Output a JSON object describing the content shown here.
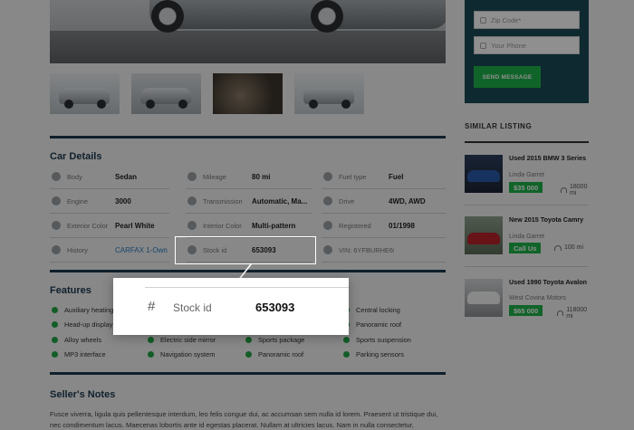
{
  "car_details": {
    "title": "Car Details",
    "rows": [
      [
        {
          "label": "Body",
          "value": "Sedan"
        },
        {
          "label": "Mileage",
          "value": "80 mi"
        },
        {
          "label": "Fuel type",
          "value": "Fuel"
        }
      ],
      [
        {
          "label": "Engine",
          "value": "3000"
        },
        {
          "label": "Transmission",
          "value": "Automatic, Ma..."
        },
        {
          "label": "Drive",
          "value": "4WD, AWD"
        }
      ],
      [
        {
          "label": "Exterior Color",
          "value": "Pearl White"
        },
        {
          "label": "Interior Color",
          "value": "Multi-pattern"
        },
        {
          "label": "Registered",
          "value": "01/1998"
        }
      ],
      [
        {
          "label": "History",
          "value": "CARFAX 1-Owner"
        },
        {
          "label": "Stock id",
          "value": "653093"
        },
        {
          "label": "",
          "value": "VIN: 6YFBURHE6FF213"
        }
      ]
    ]
  },
  "features": {
    "title": "Features",
    "items": [
      [
        "Auxiliary heating",
        "",
        "",
        "Central locking"
      ],
      [
        "Head-up display",
        "",
        "",
        "Panoramic roof"
      ],
      [
        "Alloy wheels",
        "Electric side mirror",
        "Sports package",
        "Sports suspension"
      ],
      [
        "MP3 interface",
        "Navigation system",
        "Panoramic roof",
        "Parking sensors"
      ]
    ]
  },
  "sellers_notes": {
    "title": "Seller's Notes",
    "text": "Fusce viverra, ligula quis pellentesque interdum, leo felis congue dui, ac accumsan sem nulla id lorem. Praesent ut tristique dui, nec condimentum lacus. Maecenas lobortis ante id egestas placerat. Nullam at ultricies lacus. Nam in nulla consectetur,"
  },
  "contact_form": {
    "zip_placeholder": "Zip Code*",
    "phone_placeholder": "Your Phone",
    "send_label": "SEND MESSAGE"
  },
  "similar": {
    "title": "SIMILAR LISTING",
    "items": [
      {
        "title": "Used 2015 BMW 3 Series",
        "seller": "Linda Garret",
        "price": "$35 000",
        "mileage": "18000 mi"
      },
      {
        "title": "New 2015 Toyota Camry",
        "seller": "Linda Garret",
        "price": "Call Us",
        "mileage": "100 mi"
      },
      {
        "title": "Used 1990 Toyota Avalon",
        "seller": "West Covina Motors",
        "price": "$65 000",
        "mileage": "118000 mi"
      }
    ]
  },
  "zoom_popup": {
    "icon": "#",
    "label": "Stock id",
    "value": "653093"
  },
  "colors": {
    "accent_green": "#1fb34a",
    "dark_teal": "#1a4a57",
    "title_navy": "#1d3a4f",
    "link_blue": "#2a7bc1"
  }
}
